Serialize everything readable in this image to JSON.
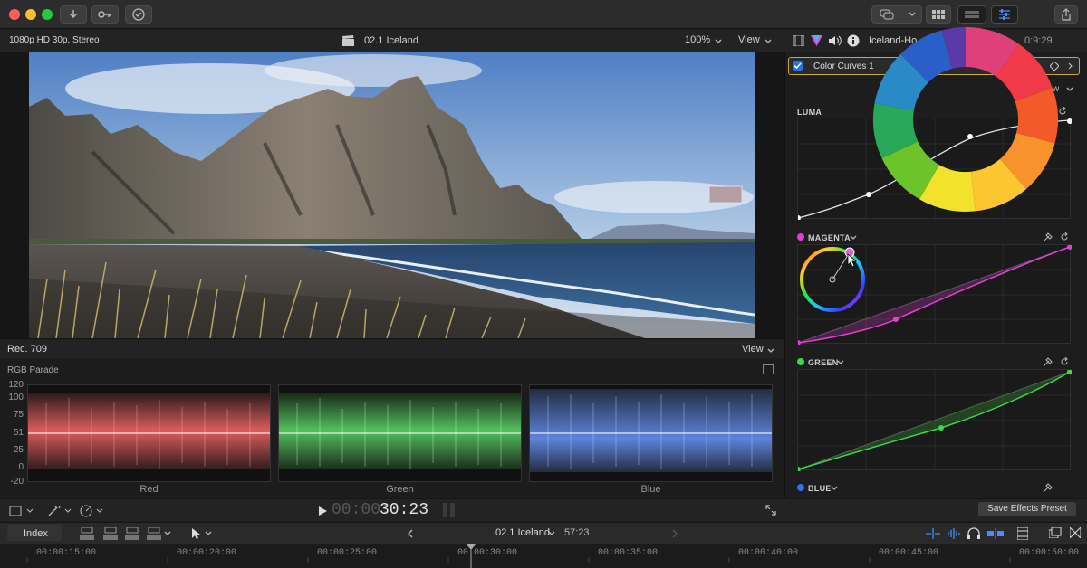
{
  "viewer": {
    "format": "1080p HD 30p, Stereo",
    "clip_title": "02.1 Iceland",
    "zoom": "100%",
    "view_menu": "View"
  },
  "scopes": {
    "color_space": "Rec. 709",
    "view_menu": "View",
    "title": "RGB Parade",
    "y_axis": [
      "120",
      "100",
      "75",
      "51",
      "25",
      "0",
      "-20"
    ],
    "channels": [
      "Red",
      "Green",
      "Blue"
    ]
  },
  "transport": {
    "timecode_dim": "00:00:",
    "timecode": "30:23"
  },
  "inspector": {
    "clip_name": "Iceland-Ho",
    "duration": "0:9:29",
    "effect_name": "Color Curves 1",
    "view_menu": "w",
    "curves": {
      "luma": "LUMA",
      "magenta": "MAGENTA",
      "green": "GREEN",
      "blue": "BLUE"
    },
    "save_preset": "Save Effects Preset"
  },
  "timeline": {
    "index_label": "Index",
    "clip_name": "02.1 Iceland",
    "duration": "57:23",
    "ruler": [
      "00:00:15:00",
      "00:00:20:00",
      "00:00:25:00",
      "00:00:30:00",
      "00:00:35:00",
      "00:00:40:00",
      "00:00:45:00",
      "00:00:50:00"
    ]
  },
  "colors": {
    "accent": "#2f6fe0",
    "magenta": "#e040d0",
    "green": "#3ed64a",
    "blue": "#3a6cf0",
    "effect_border": "#c9a640"
  },
  "icons": [
    "close-icon",
    "minimize-icon",
    "zoom-icon",
    "import-icon",
    "keyword-icon",
    "checkmark-icon",
    "speech-bubble-icon",
    "browser-icon",
    "timeline-icon",
    "inspector-icon",
    "share-icon",
    "clapper-icon",
    "film-icon",
    "color-icon",
    "audio-icon",
    "info-icon",
    "eyedropper-icon",
    "reset-icon",
    "play-icon",
    "fullscreen-icon",
    "headphones-icon",
    "arrow-tool-icon"
  ]
}
